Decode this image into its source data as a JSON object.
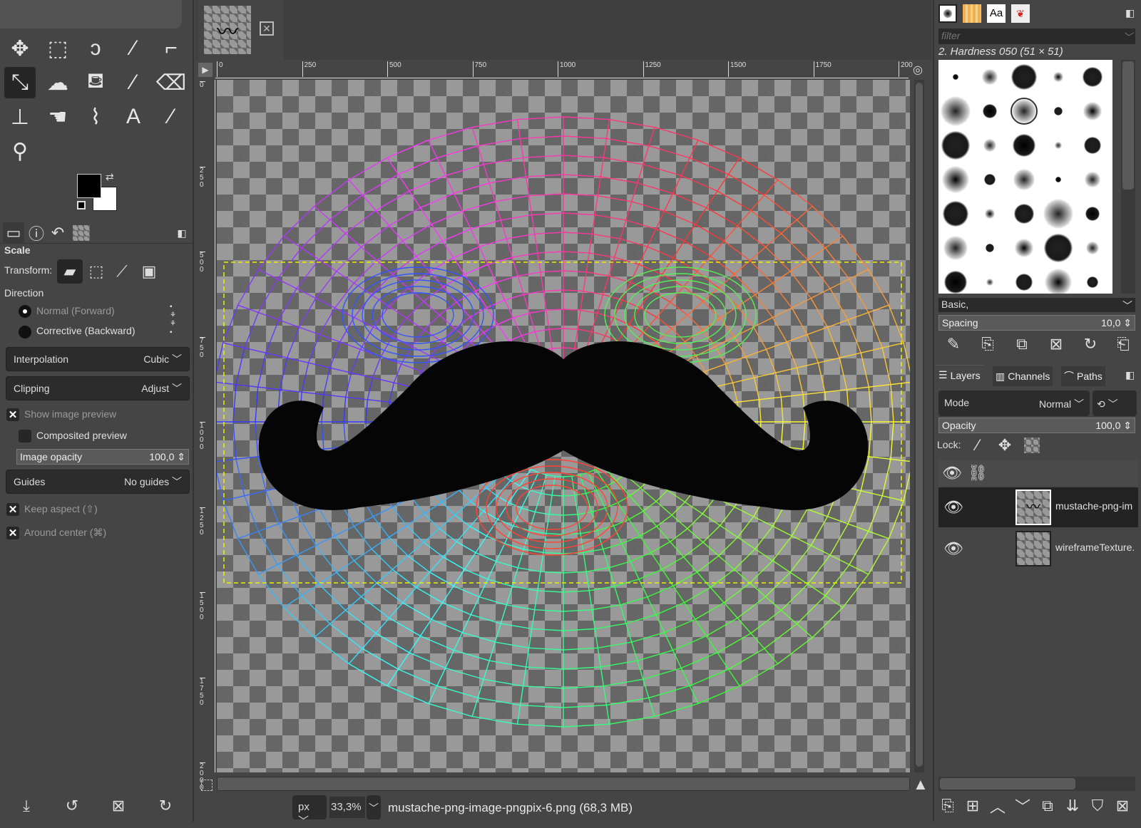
{
  "toolbox": {
    "tools": [
      {
        "name": "move-tool",
        "glyph": "✥"
      },
      {
        "name": "rect-select-tool",
        "glyph": "⬚"
      },
      {
        "name": "free-select-tool",
        "glyph": "ↄ"
      },
      {
        "name": "fuzzy-select-tool",
        "glyph": "⁄"
      },
      {
        "name": "crop-tool",
        "glyph": "⌐"
      },
      {
        "name": "scale-tool",
        "glyph": "⤡",
        "selected": true
      },
      {
        "name": "warp-tool",
        "glyph": "☁"
      },
      {
        "name": "bucket-fill-tool",
        "glyph": "⛾"
      },
      {
        "name": "paintbrush-tool",
        "glyph": "⁄"
      },
      {
        "name": "eraser-tool",
        "glyph": "⌫"
      },
      {
        "name": "clone-tool",
        "glyph": "⊥"
      },
      {
        "name": "smudge-tool",
        "glyph": "☚"
      },
      {
        "name": "paths-tool",
        "glyph": "⌇"
      },
      {
        "name": "text-tool",
        "glyph": "A"
      },
      {
        "name": "color-picker-tool",
        "glyph": "⁄"
      },
      {
        "name": "zoom-tool",
        "glyph": "⚲"
      }
    ],
    "fg_color": "#000000",
    "bg_color": "#ffffff"
  },
  "tool_options": {
    "title": "Scale",
    "transform_label": "Transform:",
    "direction_label": "Direction",
    "direction_options": [
      "Normal (Forward)",
      "Corrective (Backward)"
    ],
    "direction_selected": "Normal (Forward)",
    "interpolation": {
      "label": "Interpolation",
      "value": "Cubic"
    },
    "clipping": {
      "label": "Clipping",
      "value": "Adjust"
    },
    "show_preview": {
      "label": "Show image preview",
      "checked": true
    },
    "composited_preview": {
      "label": "Composited preview",
      "checked": false
    },
    "image_opacity": {
      "label": "Image opacity",
      "value": "100,0"
    },
    "guides": {
      "label": "Guides",
      "value": "No guides"
    },
    "keep_aspect": {
      "label": "Keep aspect (⇧)",
      "checked": true
    },
    "around_center": {
      "label": "Around center (⌘)",
      "checked": true
    }
  },
  "canvas": {
    "ruler_h": [
      "0",
      "250",
      "500",
      "750",
      "1000",
      "1250",
      "1500",
      "1750",
      "200"
    ],
    "ruler_v": [
      "0",
      "250",
      "500",
      "750",
      "1000",
      "1250",
      "1500",
      "1750",
      "2000"
    ],
    "unit": "px",
    "zoom": "33,3%",
    "status": "mustache-png-image-pngpix-6.png (68,3 MB)"
  },
  "brushes": {
    "filter_placeholder": "filter",
    "current": "2. Hardness 050 (51 × 51)",
    "tag": "Basic,",
    "spacing": {
      "label": "Spacing",
      "value": "10,0"
    }
  },
  "layers": {
    "tabs": [
      "Layers",
      "Channels",
      "Paths"
    ],
    "mode": {
      "label": "Mode",
      "value": "Normal"
    },
    "opacity": {
      "label": "Opacity",
      "value": "100,0"
    },
    "lock_label": "Lock:",
    "items": [
      {
        "name": "mustache-png-im",
        "selected": true
      },
      {
        "name": "wireframeTexture.",
        "selected": false
      }
    ]
  }
}
